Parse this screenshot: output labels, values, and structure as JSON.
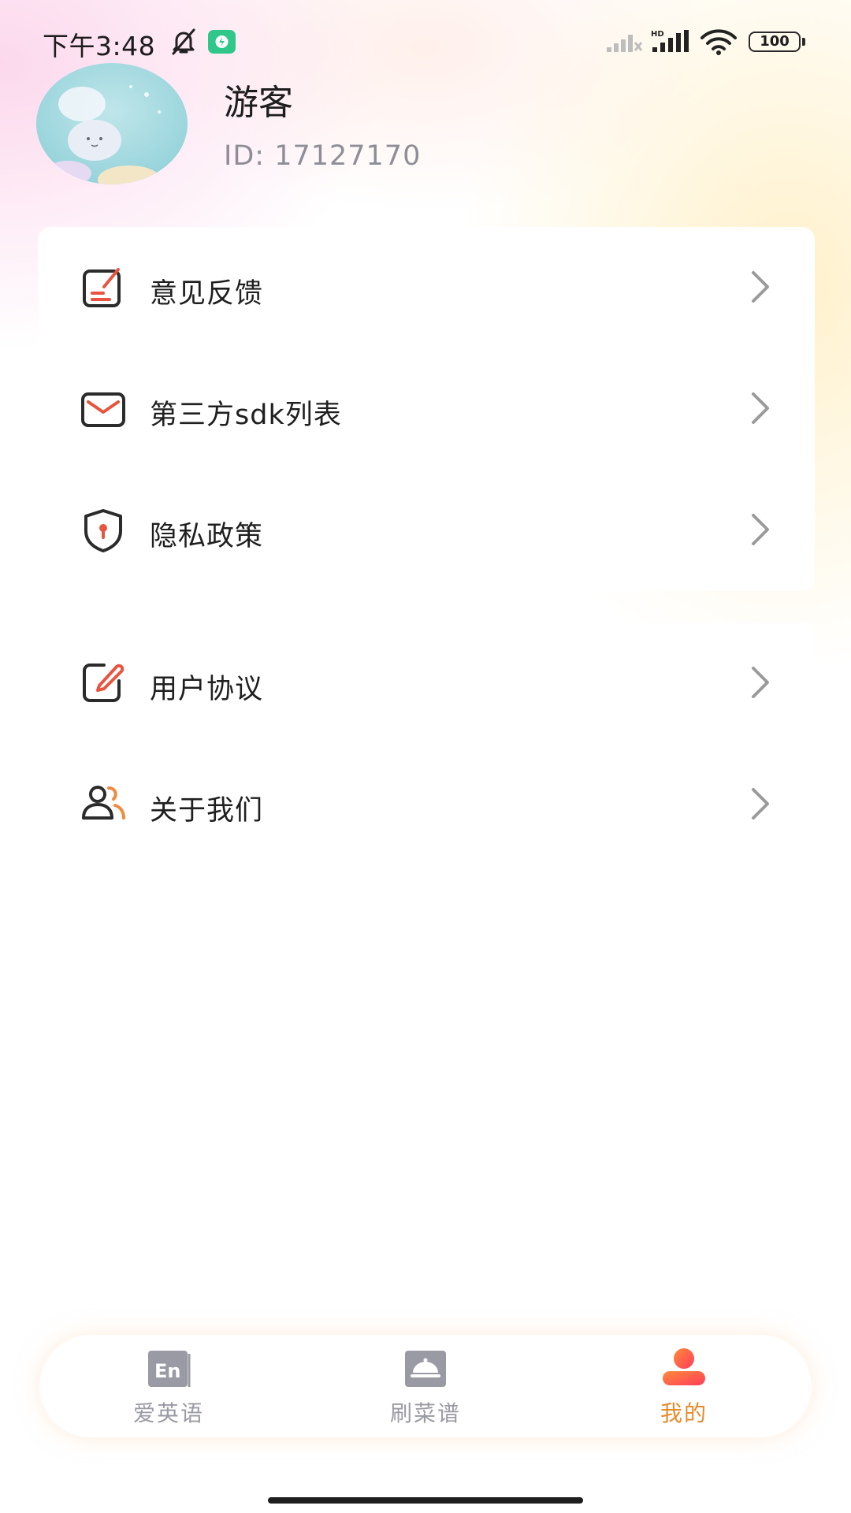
{
  "status_bar": {
    "time": "下午3:48",
    "battery": "100",
    "icons": [
      "bell-off-icon",
      "app-badge-icon",
      "signal-icon",
      "signal-hd-icon",
      "wifi-icon",
      "battery-icon"
    ]
  },
  "profile": {
    "name": "游客",
    "id_text": "ID: 17127170"
  },
  "menu_group_1": [
    {
      "label": "意见反馈",
      "icon": "feedback-icon"
    },
    {
      "label": "第三方sdk列表",
      "icon": "mail-icon"
    },
    {
      "label": "隐私政策",
      "icon": "shield-icon"
    }
  ],
  "menu_group_2": [
    {
      "label": "用户协议",
      "icon": "edit-icon"
    },
    {
      "label": "关于我们",
      "icon": "users-icon"
    }
  ],
  "tab_bar": {
    "tabs": [
      {
        "label": "爱英语",
        "icon": "english-book-icon",
        "active": false
      },
      {
        "label": "刷菜谱",
        "icon": "dish-cover-icon",
        "active": false
      },
      {
        "label": "我的",
        "icon": "user-profile-icon",
        "active": true
      }
    ]
  },
  "colors": {
    "accent": "#e78a2a",
    "icon_red": "#e8543f",
    "icon_orange": "#f08a3c",
    "inactive": "#9a9aa4",
    "text": "#1f1f1f"
  }
}
